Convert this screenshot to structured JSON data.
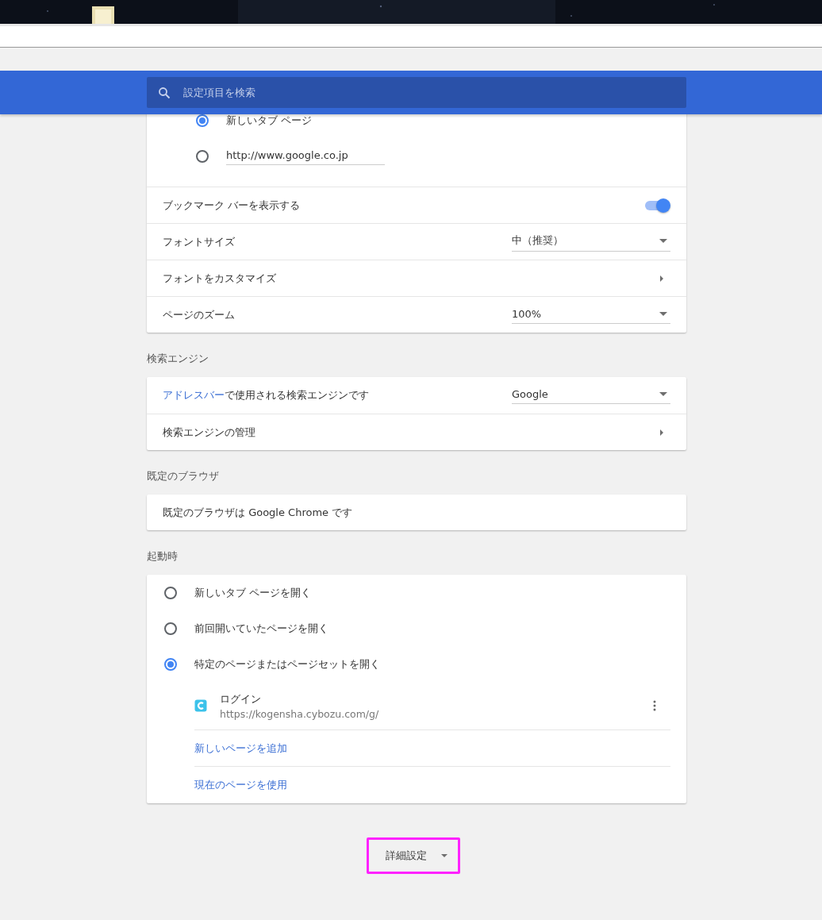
{
  "search": {
    "placeholder": "設定項目を検索"
  },
  "new_tab_options": [
    {
      "kind": "radio",
      "label": "新しいタブ ページ",
      "selected": true
    },
    {
      "kind": "url",
      "value": "http://www.google.co.jp",
      "selected": false
    }
  ],
  "appearance_rows": [
    {
      "kind": "toggle",
      "label": "ブックマーク バーを表示する",
      "on": true
    },
    {
      "kind": "select",
      "label": "フォントサイズ",
      "value": "中（推奨）"
    },
    {
      "kind": "link",
      "label": "フォントをカスタマイズ"
    },
    {
      "kind": "select",
      "label": "ページのズーム",
      "value": "100%"
    }
  ],
  "search_engine": {
    "heading": "検索エンジン",
    "rows": [
      {
        "kind": "select",
        "link": "アドレスバー",
        "label": "で使用される検索エンジンです",
        "value": "Google"
      },
      {
        "kind": "link",
        "label": "検索エンジンの管理"
      }
    ]
  },
  "default_browser": {
    "heading": "既定のブラウザ",
    "text": "既定のブラウザは Google Chrome です"
  },
  "startup": {
    "heading": "起動時",
    "options": [
      {
        "label": "新しいタブ ページを開く",
        "selected": false
      },
      {
        "label": "前回開いていたページを開く",
        "selected": false
      },
      {
        "label": "特定のページまたはページセットを開く",
        "selected": true
      }
    ],
    "pages": [
      {
        "title": "ログイン",
        "url": "https://kogensha.cybozu.com/g/"
      }
    ],
    "actions": [
      "新しいページを追加",
      "現在のページを使用"
    ]
  },
  "advanced": {
    "label": "詳細設定",
    "highlighted": true
  }
}
